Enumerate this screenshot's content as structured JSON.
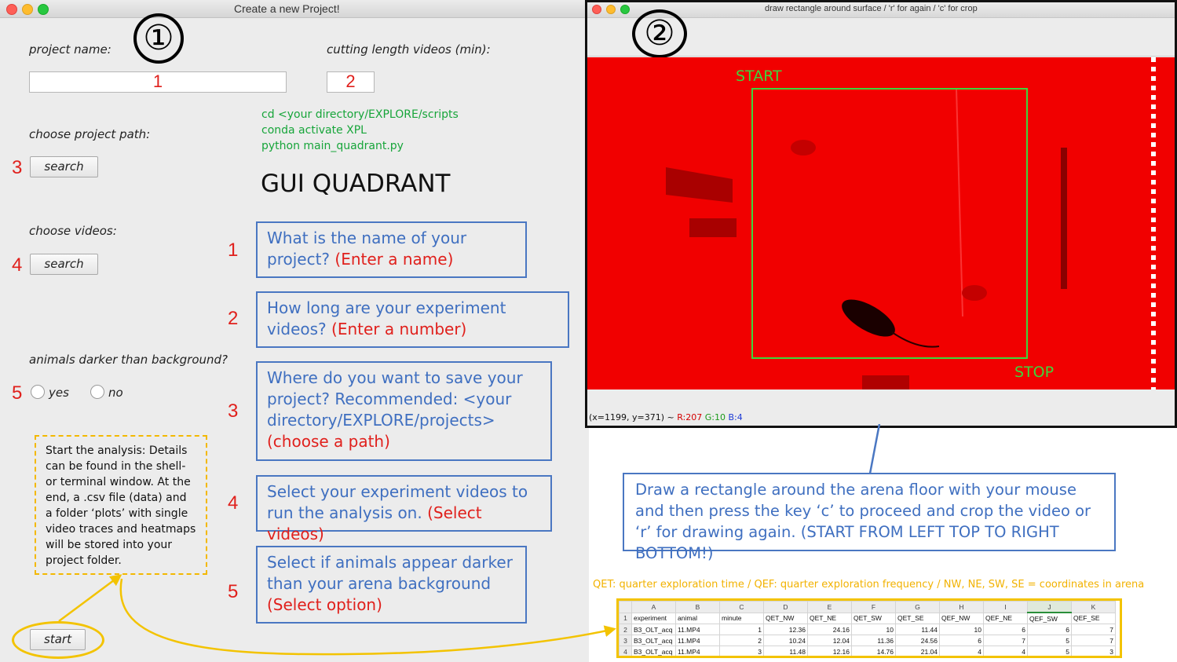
{
  "window1": {
    "title": "Create a new Project!",
    "step_marker": "①",
    "project_name_label": "project name:",
    "project_name_value": "1",
    "cutting_length_label": "cutting length videos (min):",
    "cutting_length_value": "2",
    "project_path_label": "choose project path:",
    "project_path_number": "3",
    "search_label": "search",
    "videos_label": "choose videos:",
    "videos_number": "4",
    "animals_darker_label": "animals darker than background?",
    "animals_number": "5",
    "radio_yes": "yes",
    "radio_no": "no",
    "start_label": "start",
    "commands": [
      "cd <your directory/EXPLORE/scripts",
      "conda activate XPL",
      "python main_quadrant.py"
    ],
    "gui_title": "GUI QUADRANT",
    "start_note": "Start the analysis: Details can be found in the shell- or terminal window. At the end, a .csv file (data) and a folder ‘plots’ with single video traces and heatmaps will be stored into your project folder.",
    "explanations": [
      {
        "number": "1",
        "text": "What is the name of your project?",
        "red": "(Enter a name)"
      },
      {
        "number": "2",
        "text": "How long are your experiment videos?",
        "red": "(Enter a number)"
      },
      {
        "number": "3",
        "text": "Where do you want to save your project? Recommended: <your directory/EXPLORE/projects>",
        "red": "(choose a path)"
      },
      {
        "number": "4",
        "text": "Select your experiment videos to run the analysis on.",
        "red": "(Select videos)"
      },
      {
        "number": "5",
        "text": "Select if animals appear darker than your arena background",
        "red": "(Select option)"
      }
    ]
  },
  "window2": {
    "title": "draw rectangle around surface / 'r' for again / 'c' for crop",
    "step_marker": "②",
    "start_label": "START",
    "stop_label": "STOP",
    "status_coords": "(x=1199, y=371) ~",
    "status_r": "R:207",
    "status_g": "G:10",
    "status_b": "B:4"
  },
  "instruction": "Draw a rectangle around the arena floor with your mouse and then press the key ‘c’ to proceed and crop the video or ‘r’ for drawing again. (START FROM LEFT TOP TO RIGHT BOTTOM!)",
  "legend": "QET: quarter exploration time / QEF: quarter exploration frequency / NW, NE, SW, SE = coordinates in arena",
  "spreadsheet": {
    "columns": [
      "",
      "A",
      "B",
      "C",
      "D",
      "E",
      "F",
      "G",
      "H",
      "I",
      "J",
      "K"
    ],
    "rows": [
      [
        "1",
        "experiment",
        "animal",
        "minute",
        "QET_NW",
        "QET_NE",
        "QET_SW",
        "QET_SE",
        "QEF_NW",
        "QEF_NE",
        "QEF_SW",
        "QEF_SE"
      ],
      [
        "2",
        "B3_OLT_acq",
        "11.MP4",
        "1",
        "12.36",
        "24.16",
        "10",
        "11.44",
        "10",
        "6",
        "6",
        "7"
      ],
      [
        "3",
        "B3_OLT_acq",
        "11.MP4",
        "2",
        "10.24",
        "12.04",
        "11.36",
        "24.56",
        "6",
        "7",
        "5",
        "7"
      ],
      [
        "4",
        "B3_OLT_acq",
        "11.MP4",
        "3",
        "11.48",
        "12.16",
        "14.76",
        "21.04",
        "4",
        "4",
        "5",
        "3"
      ]
    ]
  },
  "colors": {
    "accent_blue": "#4a77c2",
    "highlight_yellow": "#f3c300",
    "number_red": "#e0201c",
    "cmd_green": "#17a53a",
    "roi_green": "#3dd63d"
  }
}
